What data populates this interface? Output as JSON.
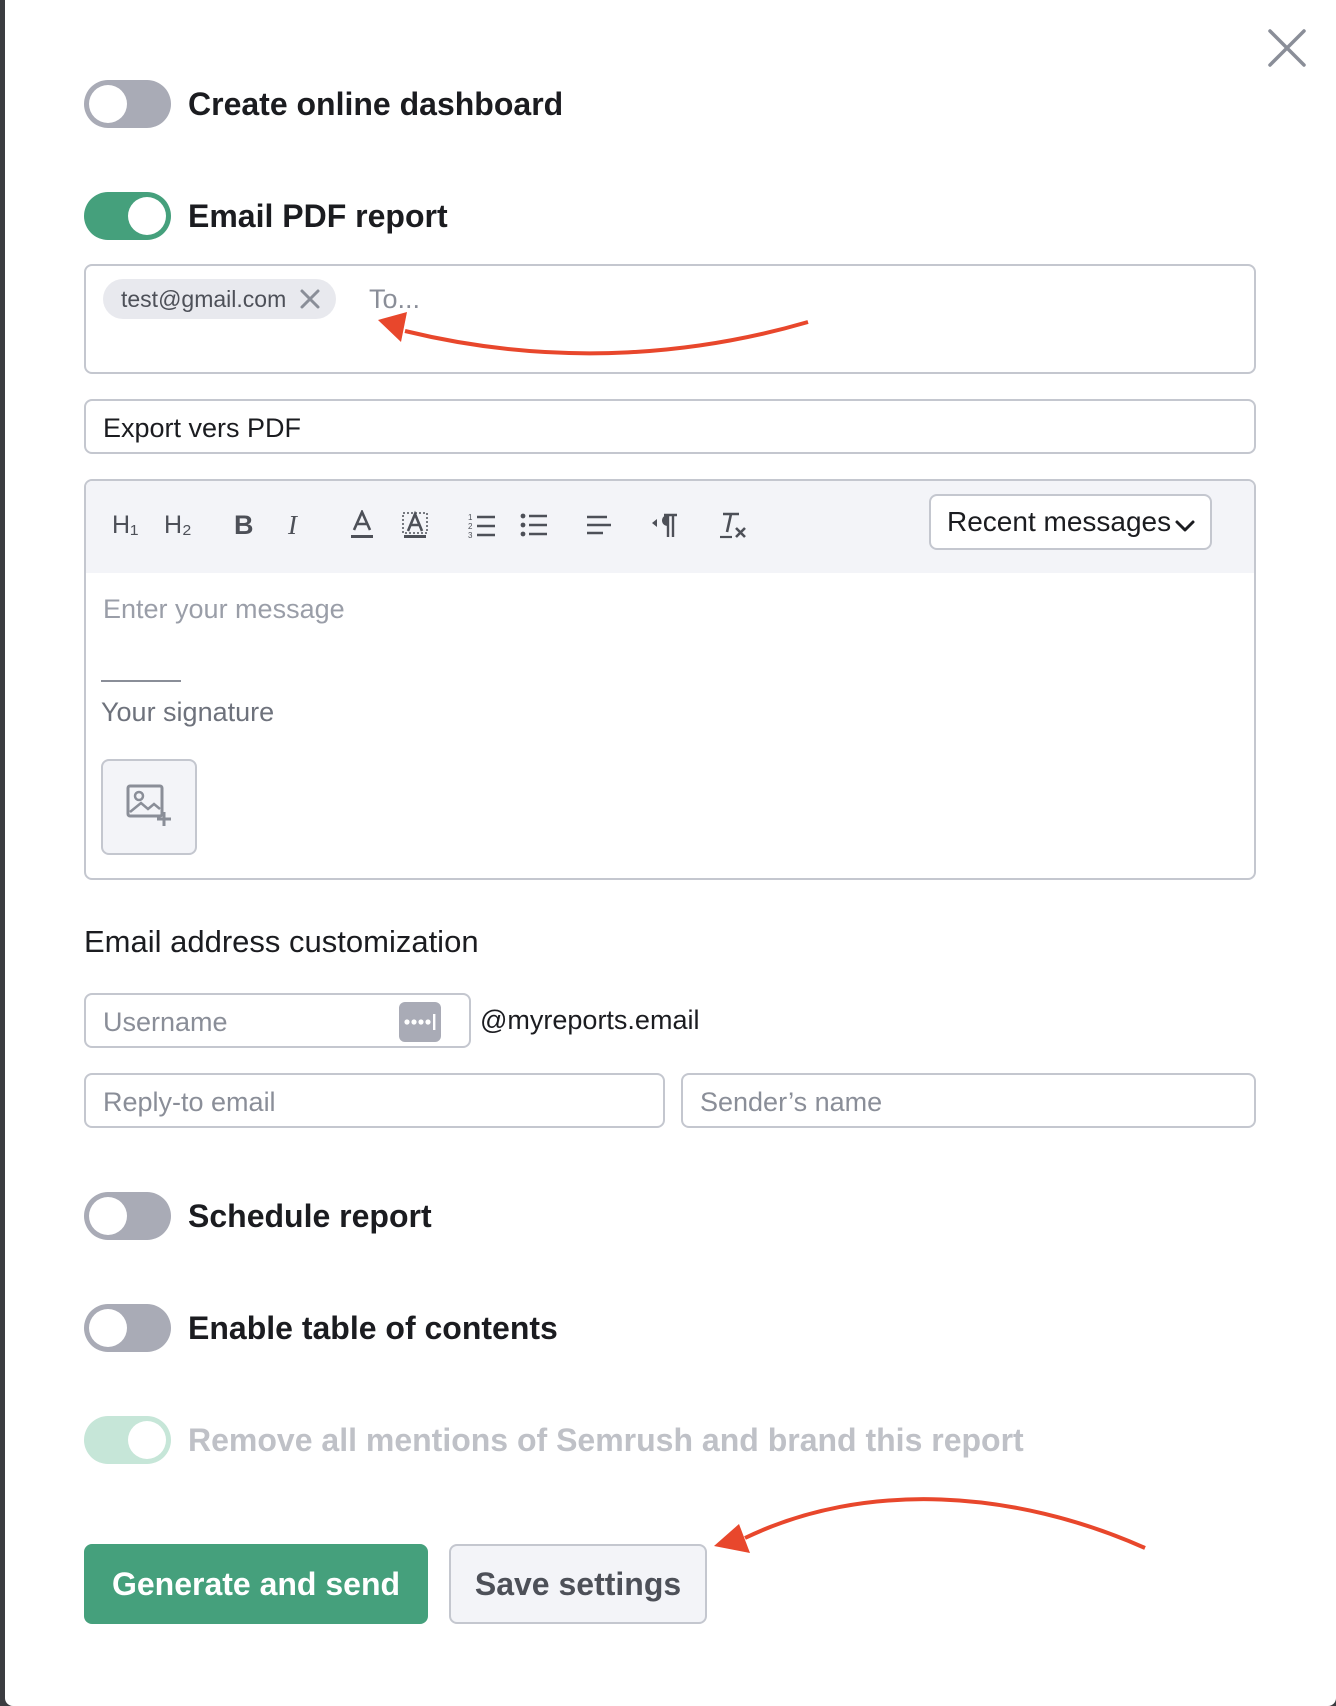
{
  "toggles": {
    "online_dashboard": {
      "label": "Create online dashboard",
      "state": "off"
    },
    "email_pdf": {
      "label": "Email PDF report",
      "state": "on"
    },
    "schedule": {
      "label": "Schedule report",
      "state": "off"
    },
    "toc": {
      "label": "Enable table of contents",
      "state": "off"
    },
    "white_label": {
      "label": "Remove all mentions of Semrush and brand this report",
      "state": "on-disabled"
    }
  },
  "recipients": {
    "chips": [
      "test@gmail.com"
    ],
    "placeholder": "To..."
  },
  "subject": {
    "value": "Export vers PDF"
  },
  "editor": {
    "toolbar": {
      "h1": "H₁",
      "h2": "H₂",
      "bold": "B",
      "italic": "I"
    },
    "recent_messages": "Recent messages",
    "message_placeholder": "Enter your message",
    "signature": "Your signature"
  },
  "customization": {
    "title": "Email address customization",
    "username_placeholder": "Username",
    "domain": "@myreports.email",
    "reply_to_placeholder": "Reply-to email",
    "sender_placeholder": "Sender’s name"
  },
  "actions": {
    "generate": "Generate and send",
    "save": "Save settings"
  },
  "colors": {
    "accent": "#45a07c",
    "annotation_arrow": "#e8472c"
  },
  "icons": [
    "close-icon",
    "remove-chip-icon",
    "text-color-icon",
    "highlight-icon",
    "ordered-list-icon",
    "bullet-list-icon",
    "align-icon",
    "rtl-icon",
    "clear-format-icon",
    "chevron-down-icon",
    "image-add-icon",
    "password-dots-icon"
  ]
}
